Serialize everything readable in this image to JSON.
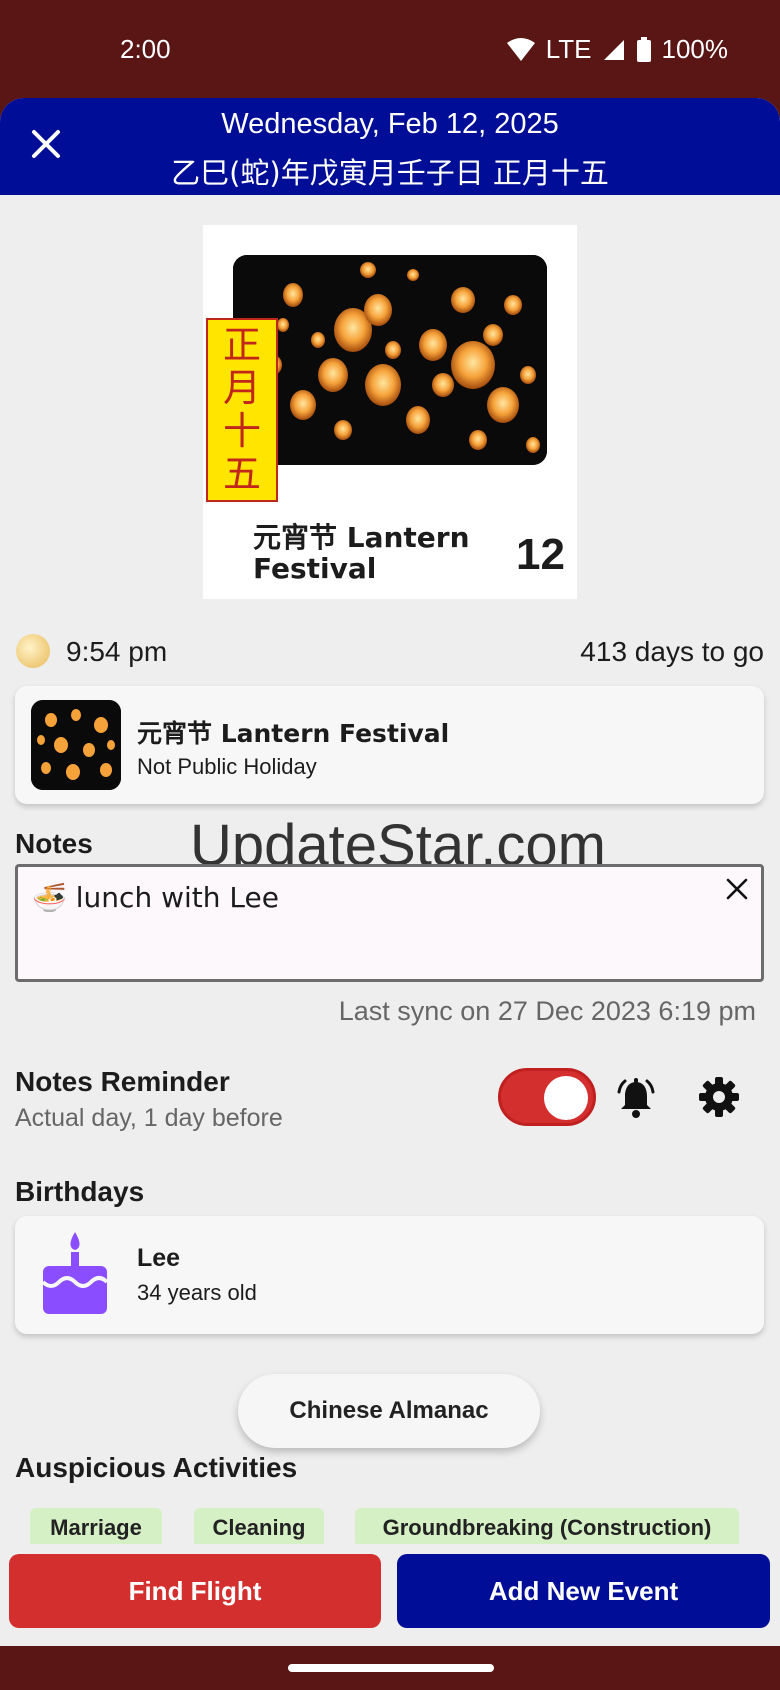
{
  "status_bar": {
    "time": "2:00",
    "network": "LTE",
    "battery": "100%"
  },
  "header": {
    "date": "Wednesday, Feb 12, 2025",
    "lunar_date": "乙巳(蛇)年戊寅月壬子日 正月十五",
    "close_icon": "close-icon"
  },
  "card": {
    "lunar_tag": [
      "正",
      "月",
      "十",
      "五"
    ],
    "title": "元宵节 Lantern Festival",
    "day": "12"
  },
  "moon": {
    "icon": "moon-icon",
    "time": "9:54 pm",
    "countdown": "413 days to go"
  },
  "festival": {
    "name": "元宵节 Lantern Festival",
    "subtitle": "Not Public Holiday"
  },
  "watermark": "UpdateStar.com",
  "notes": {
    "label": "Notes",
    "value": "lunch with Lee",
    "emoji": "🍜",
    "sync": "Last sync on 27 Dec 2023 6:19 pm"
  },
  "reminder": {
    "title": "Notes Reminder",
    "subtitle": "Actual day, 1 day before",
    "enabled": true,
    "accent": "#d32f2f"
  },
  "birthdays": {
    "label": "Birthdays",
    "items": [
      {
        "name": "Lee",
        "age": "34 years old",
        "icon": "cake-icon"
      }
    ],
    "icon_color": "#8a4dff"
  },
  "almanac_button": "Chinese Almanac",
  "auspicious": {
    "label": "Auspicious Activities",
    "chips": [
      "Marriage",
      "Cleaning",
      "Groundbreaking (Construction)"
    ]
  },
  "actions": {
    "find_flight": "Find Flight",
    "add_event": "Add New Event"
  },
  "colors": {
    "header": "#000d96",
    "danger": "#d32f2f",
    "frame": "#5a1515",
    "chip": "#d6f0c6"
  }
}
